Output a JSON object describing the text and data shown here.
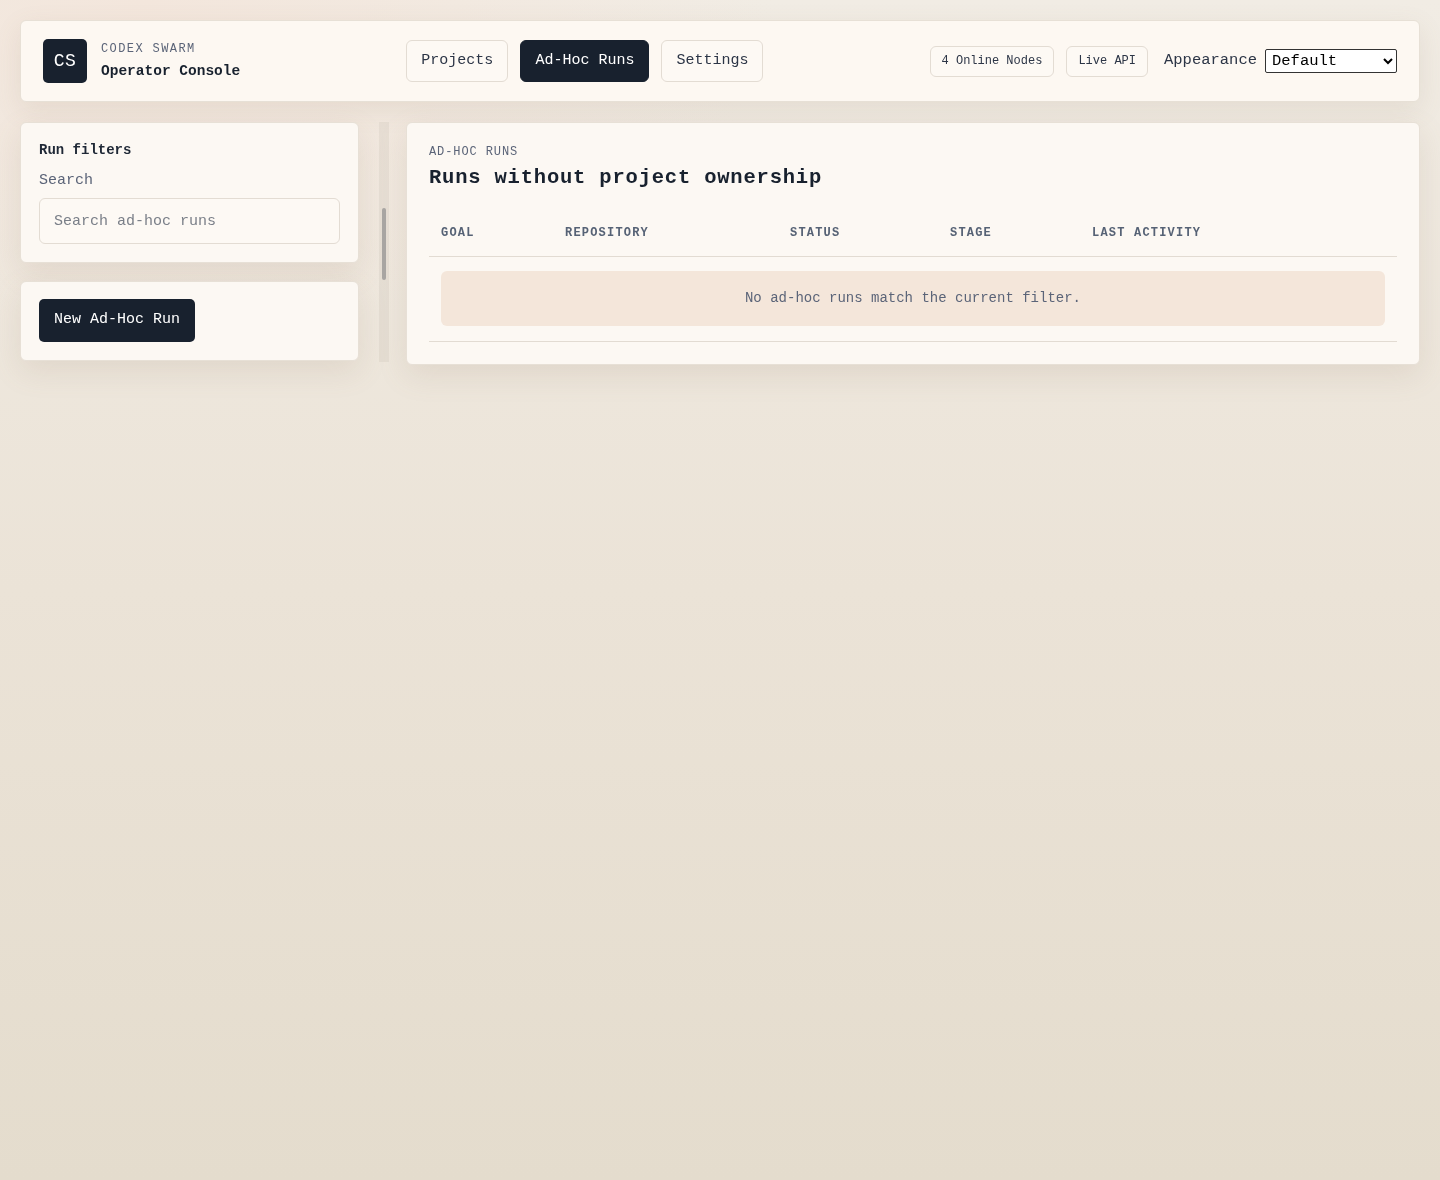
{
  "brand": {
    "logo": "CS",
    "eyebrow": "CODEX SWARM",
    "title": "Operator Console"
  },
  "nav": [
    {
      "label": "Projects",
      "selected": false
    },
    {
      "label": "Ad-Hoc Runs",
      "selected": true
    },
    {
      "label": "Settings",
      "selected": false
    }
  ],
  "status_badges": [
    "4 Online Nodes",
    "Live API"
  ],
  "appearance": {
    "label": "Appearance",
    "value": "Default"
  },
  "sidebar": {
    "filters": {
      "title": "Run filters",
      "search_label": "Search",
      "placeholder": "Search ad-hoc runs"
    },
    "new_run_button": "New Ad-Hoc Run"
  },
  "main": {
    "eyebrow": "AD-HOC RUNS",
    "title": "Runs without project ownership",
    "table": {
      "columns": [
        "GOAL",
        "REPOSITORY",
        "STATUS",
        "STAGE",
        "LAST ACTIVITY"
      ],
      "empty_message": "No ad-hoc runs match the current filter."
    }
  }
}
